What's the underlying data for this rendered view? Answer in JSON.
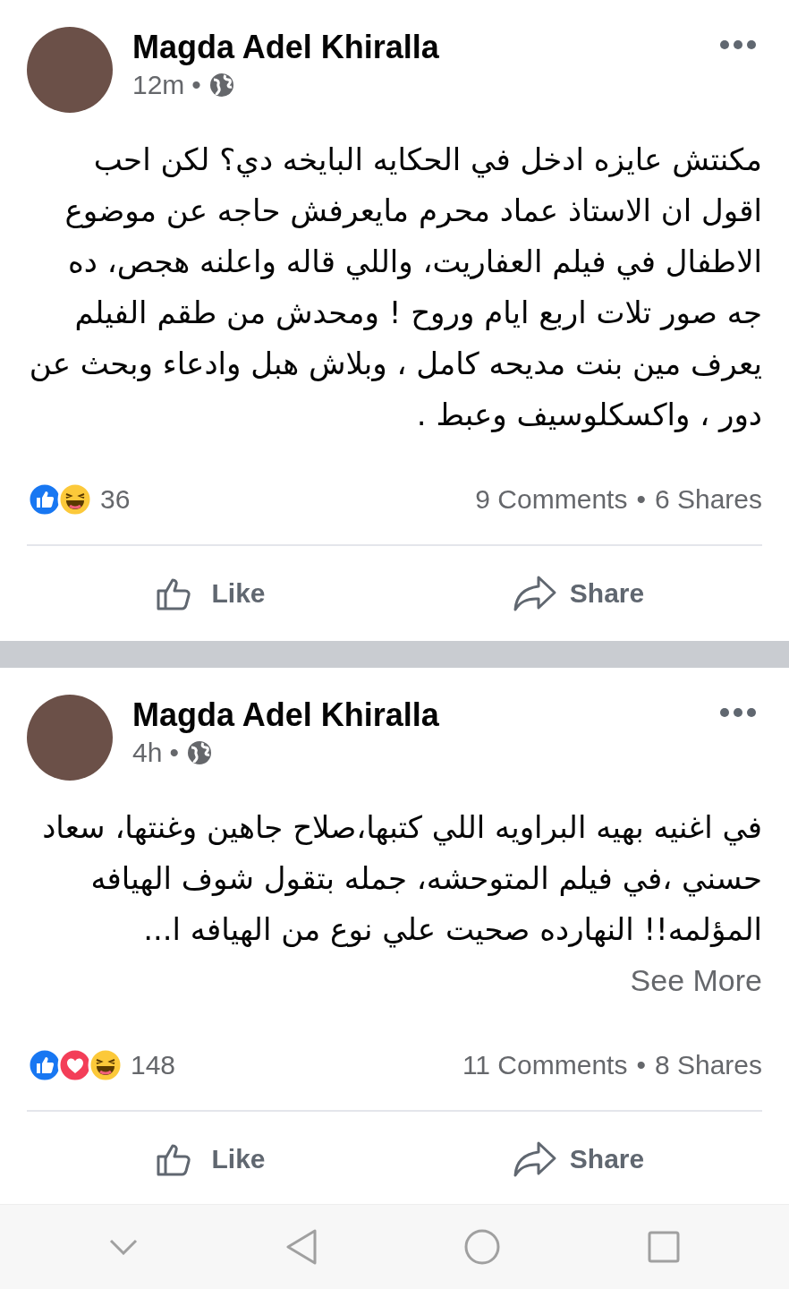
{
  "posts": [
    {
      "author": "Magda Adel Khiralla",
      "time": "12m",
      "time_separator": "•",
      "text": "مكنتش عايزه ادخل في الحكايه البايخه دي؟ لكن احب اقول ان الاستاذ عماد محرم مايعرفش حاجه عن موضوع  الاطفال في فيلم العفاريت، واللي قاله  واعلنه هجص، ده جه صور تلات اربع ايام وروح ! ومحدش من طقم الفيلم يعرف مين بنت مديحه كامل ، وبلاش هبل وادعاء وبحث عن  دور ، واكسكلوسيف وعبط .",
      "reactions": [
        {
          "kind": "like"
        },
        {
          "kind": "haha"
        }
      ],
      "reaction_count": "36",
      "comments": "9 Comments",
      "stat_separator": "•",
      "shares": "6 Shares",
      "like_label": "Like",
      "share_label": "Share"
    },
    {
      "author": "Magda Adel Khiralla",
      "time": "4h",
      "time_separator": "•",
      "text": "في اغنيه بهيه البراويه اللي كتبها،صلاح جاهين وغنتها، سعاد حسني ،في فيلم المتوحشه، جمله بتقول شوف الهيافه المؤلمه!!  النهارده صحيت علي نوع من الهيافه ا...",
      "see_more": "See More",
      "reactions": [
        {
          "kind": "like"
        },
        {
          "kind": "love"
        },
        {
          "kind": "haha"
        }
      ],
      "reaction_count": "148",
      "comments": "11 Comments",
      "stat_separator": "•",
      "shares": "8 Shares",
      "like_label": "Like",
      "share_label": "Share"
    }
  ]
}
